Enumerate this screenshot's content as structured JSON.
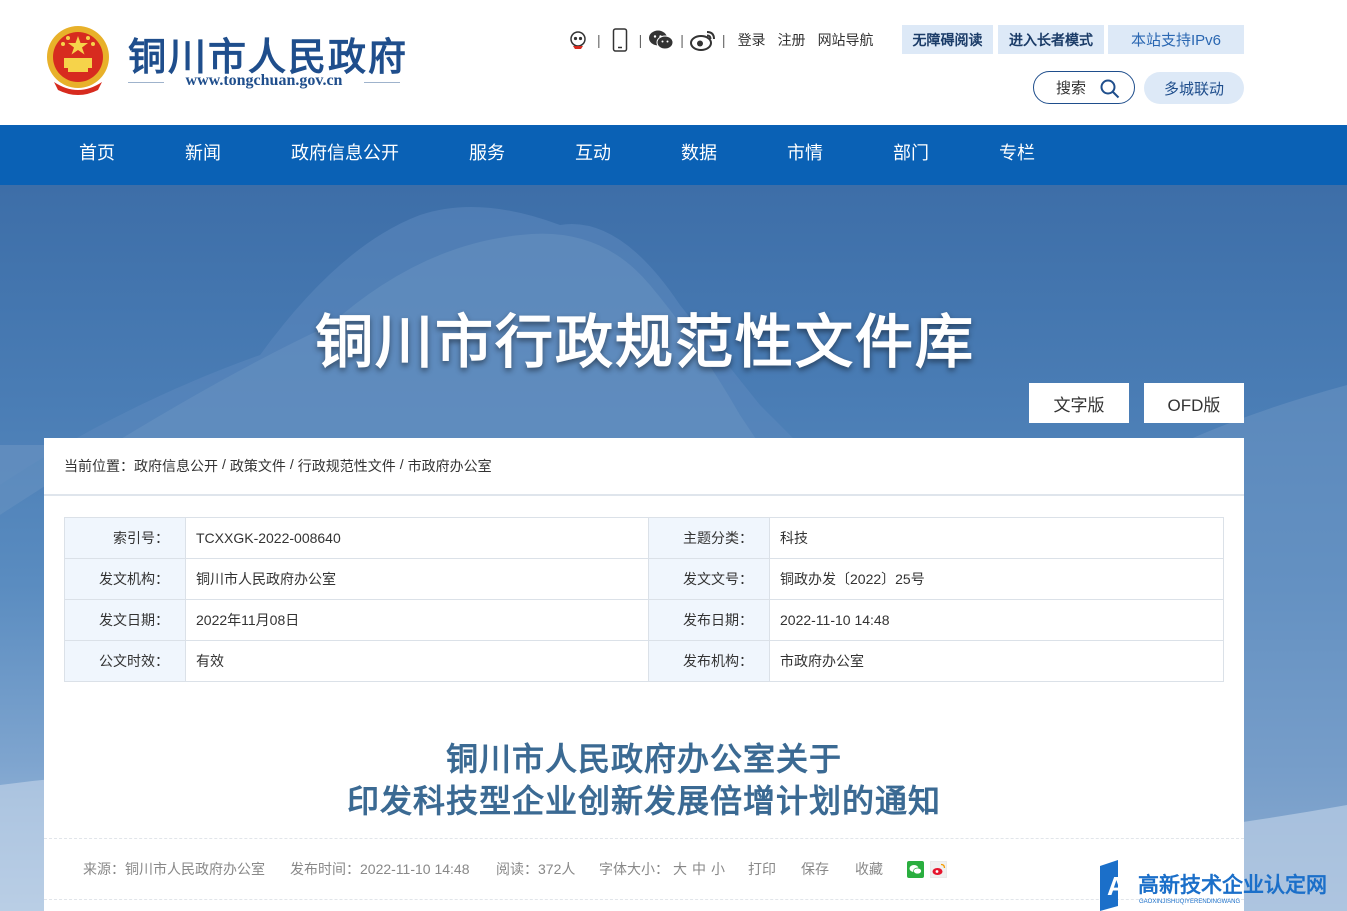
{
  "header": {
    "site_title": "铜川市人民政府",
    "site_url": "www.tongchuan.gov.cn",
    "links": {
      "login": "登录",
      "register": "注册",
      "site_nav": "网站导航"
    },
    "accessibility": "无障碍阅读",
    "elder_mode": "进入长者模式",
    "ipv6": "本站支持IPv6",
    "search": "搜索",
    "multi_city": "多城联动",
    "icons": [
      "robot-icon",
      "mobile-icon",
      "wechat-icon",
      "weibo-icon"
    ]
  },
  "nav": {
    "items": [
      {
        "label": "首页"
      },
      {
        "label": "新闻"
      },
      {
        "label": "政府信息公开"
      },
      {
        "label": "服务"
      },
      {
        "label": "互动"
      },
      {
        "label": "数据"
      },
      {
        "label": "市情"
      },
      {
        "label": "部门"
      },
      {
        "label": "专栏"
      }
    ]
  },
  "banner": {
    "title": "铜川市行政规范性文件库",
    "text_version": "文字版",
    "ofd_version": "OFD版"
  },
  "breadcrumb": {
    "prefix": "当前位置：",
    "items": [
      "政府信息公开",
      "政策文件",
      "行政规范性文件",
      "市政府办公室"
    ]
  },
  "meta": {
    "rows": [
      {
        "k1": "索引号：",
        "v1": "TCXXGK-2022-008640",
        "k2": "主题分类：",
        "v2": "科技"
      },
      {
        "k1": "发文机构：",
        "v1": "铜川市人民政府办公室",
        "k2": "发文文号：",
        "v2": "铜政办发〔2022〕25号"
      },
      {
        "k1": "发文日期：",
        "v1": "2022年11月08日",
        "k2": "发布日期：",
        "v2": "2022-11-10 14:48"
      },
      {
        "k1": "公文时效：",
        "v1": "有效",
        "k2": "发布机构：",
        "v2": "市政府办公室"
      }
    ]
  },
  "document": {
    "title_line1": "铜川市人民政府办公室关于",
    "title_line2": "印发科技型企业创新发展倍增计划的通知"
  },
  "info_bar": {
    "source": "来源：铜川市人民政府办公室",
    "publish_time": "发布时间：2022-11-10 14:48",
    "reads": "阅读：372人",
    "font_size_label": "字体大小：",
    "font_large": "大",
    "font_medium": "中",
    "font_small": "小",
    "print": "打印",
    "save": "保存",
    "favorite": "收藏"
  },
  "watermark": {
    "text": "高新技术企业认定网",
    "subtext": "GAOXINJISHUQIYERENDINGWANG"
  },
  "colors": {
    "brand_blue": "#0a61b5",
    "title_blue": "#1f4e8c",
    "valid_green": "#1a8a1a"
  }
}
